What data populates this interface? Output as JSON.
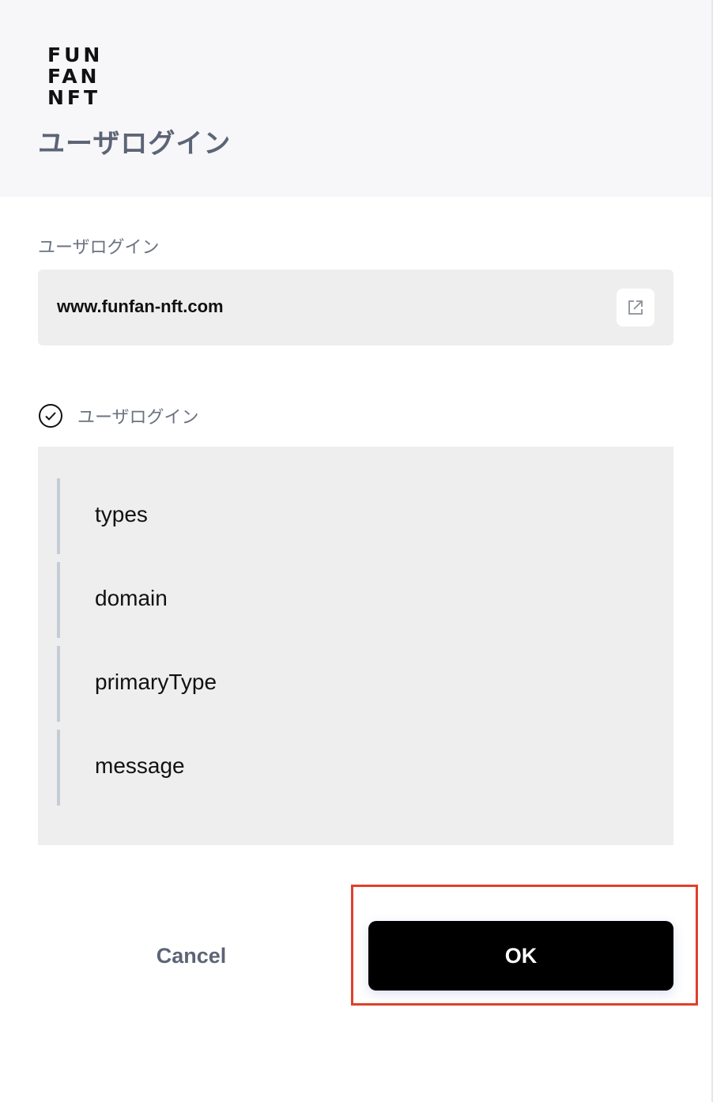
{
  "colors": {
    "accent_highlight": "#e0402a",
    "ok_background": "#000000",
    "header_background": "#f7f7f9",
    "panel_background": "#eeeeee"
  },
  "header": {
    "logo_lines": [
      "FUN",
      "FAN",
      "NFT"
    ],
    "title": "ユーザログイン"
  },
  "site_section": {
    "label": "ユーザログイン",
    "url": "www.funfan-nft.com",
    "open_icon": "external-link-icon"
  },
  "message_section": {
    "check_icon": "check-circle-icon",
    "label": "ユーザログイン",
    "fields": [
      "types",
      "domain",
      "primaryType",
      "message"
    ]
  },
  "actions": {
    "cancel_label": "Cancel",
    "ok_label": "OK"
  }
}
